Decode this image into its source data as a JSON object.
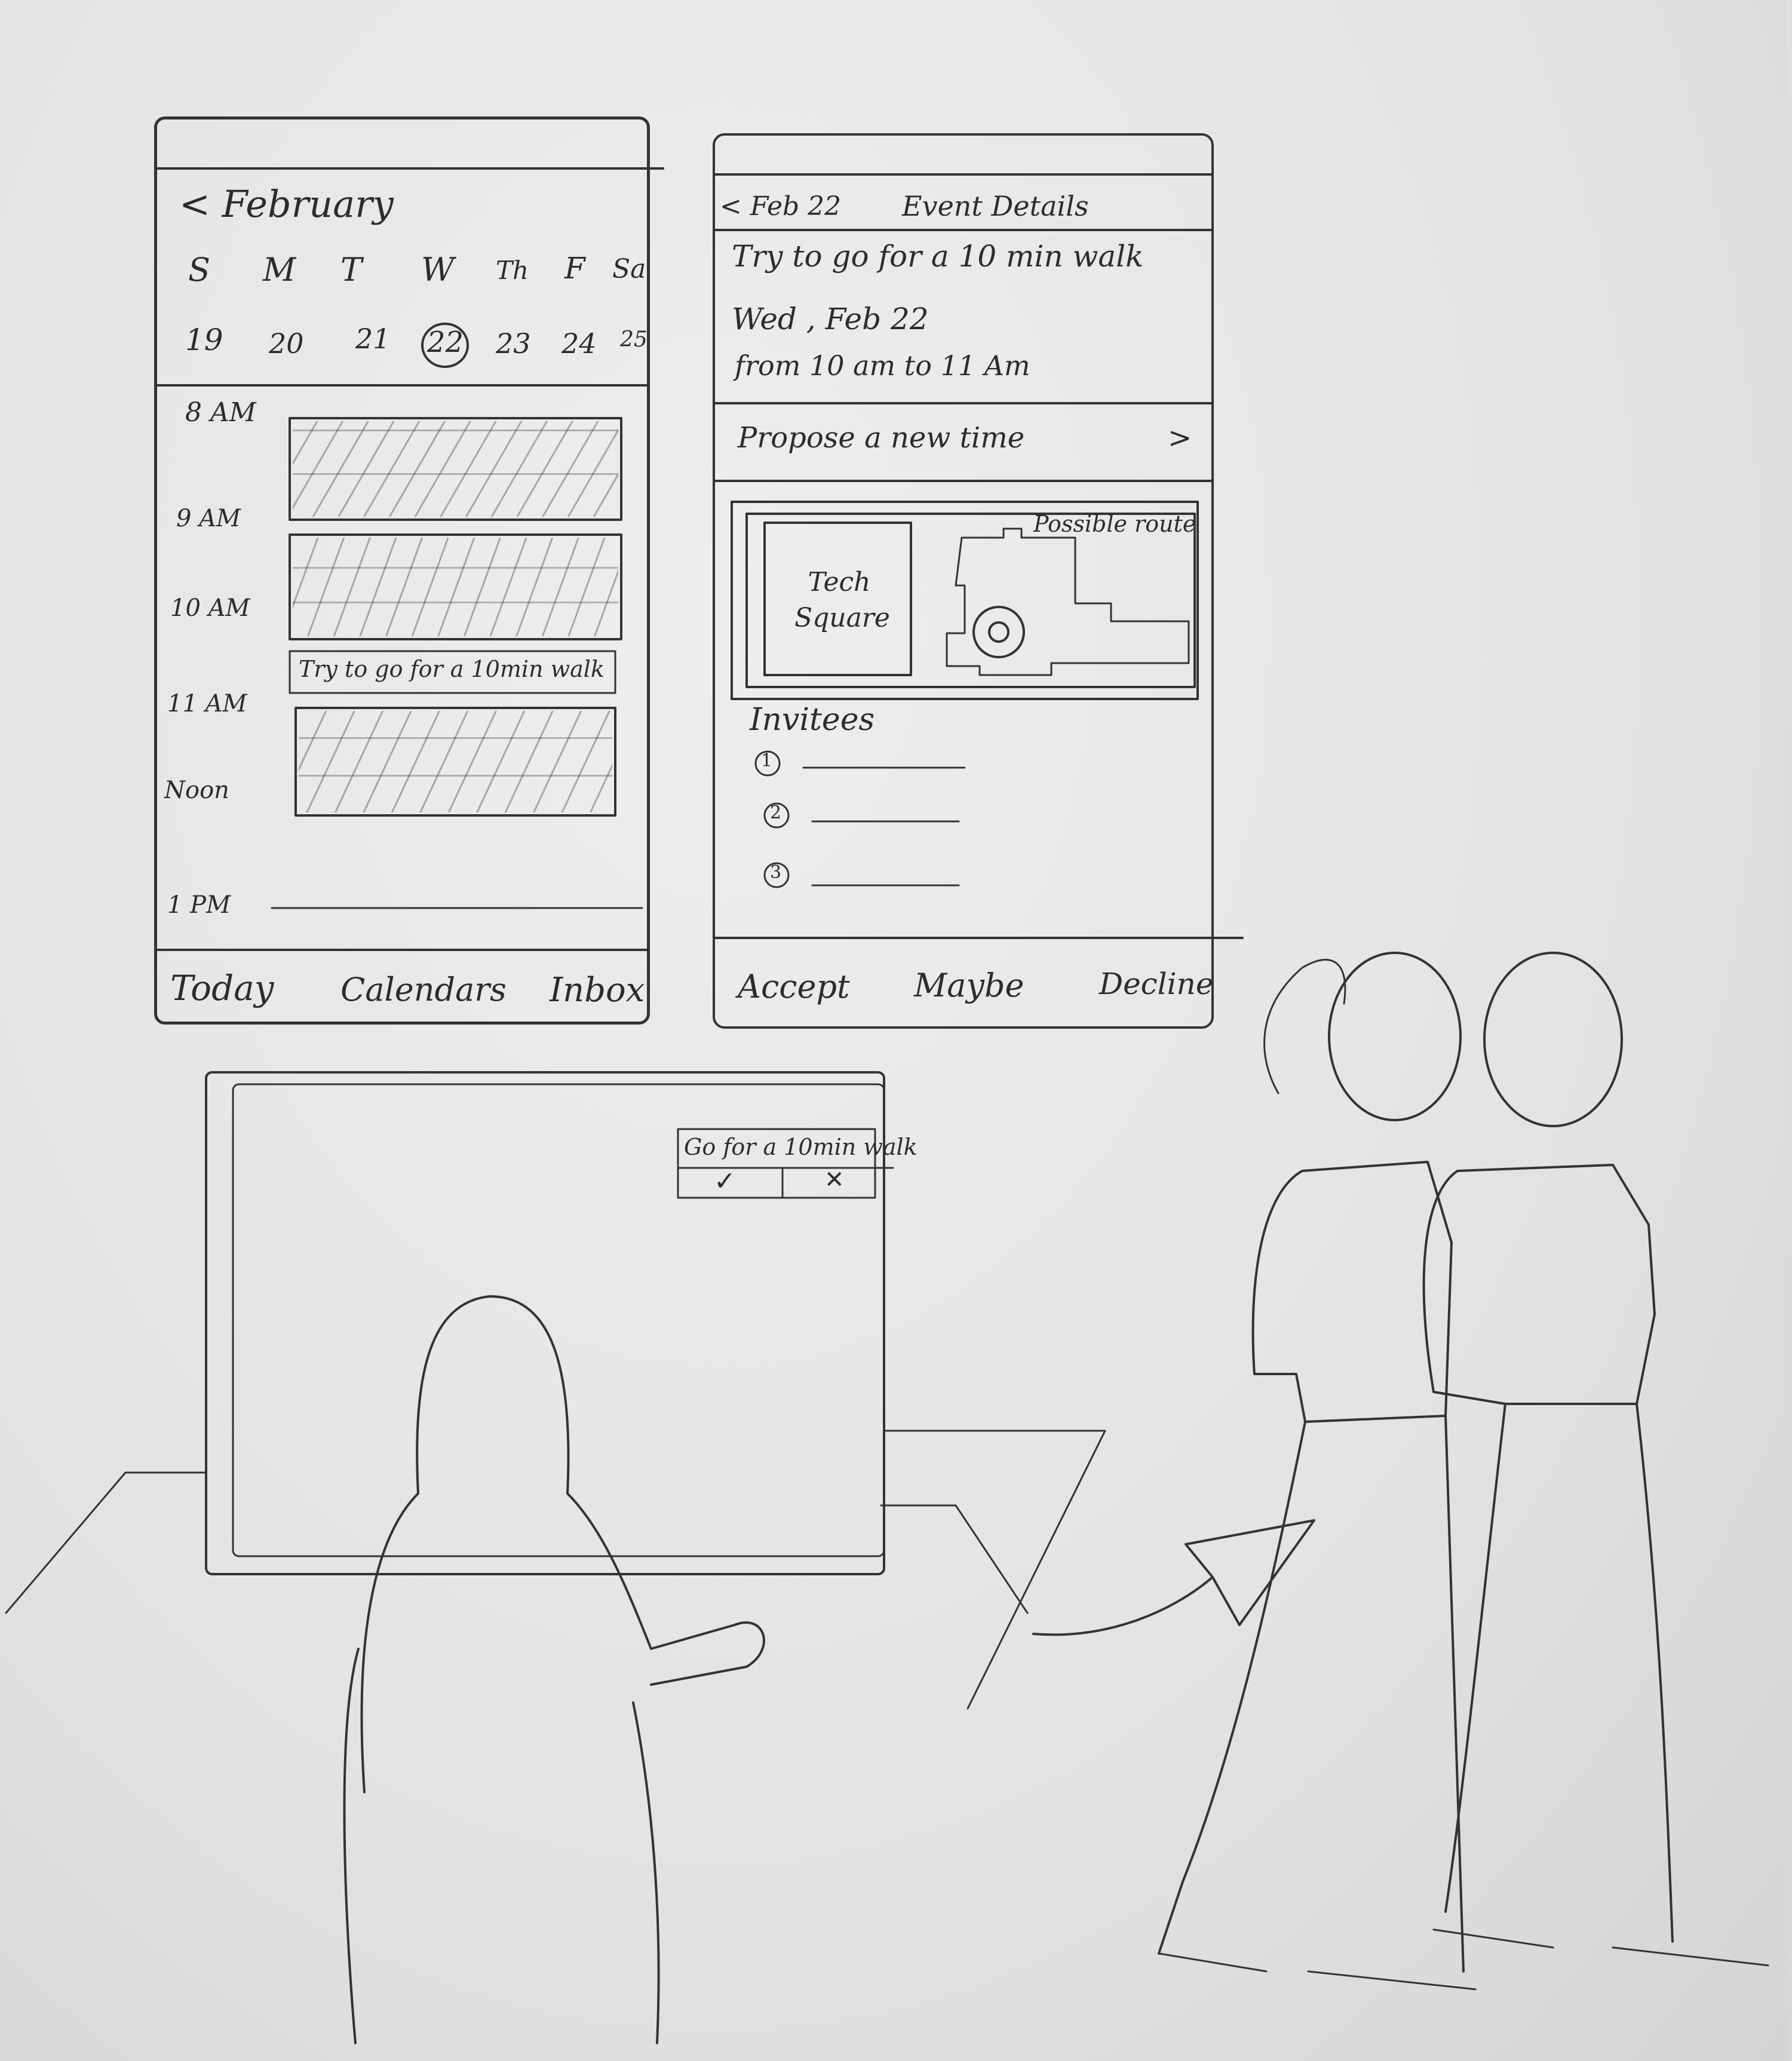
{
  "calendar_screen": {
    "month_back": "< February",
    "weekdays": [
      "S",
      "M",
      "T",
      "W",
      "Th",
      "F",
      "Sa"
    ],
    "dates": [
      "19",
      "20",
      "21",
      "22",
      "23",
      "24",
      "25"
    ],
    "selected_date": "22",
    "times": [
      "8 AM",
      "9 AM",
      "10 AM",
      "11 AM",
      "Noon",
      "1 PM"
    ],
    "event_label": "Try to go for a 10min walk",
    "tabs": [
      "Today",
      "Calendars",
      "Inbox"
    ]
  },
  "event_screen": {
    "back": "< Feb 22",
    "title": "Event Details",
    "event_title": "Try to go for a 10 min walk",
    "date": "Wed , Feb 22",
    "time_range": "from 10 am to 11 Am",
    "propose": "Propose a new time",
    "propose_arrow": ">",
    "map_building": "Tech Square",
    "map_label": "Possible route",
    "invitees_heading": "Invitees",
    "invitees": [
      "1",
      "2",
      "3"
    ],
    "actions": [
      "Accept",
      "Maybe",
      "Decline"
    ]
  },
  "desktop_notification": {
    "text": "Go for a 10min walk",
    "accept_symbol": "✓",
    "reject_symbol": "✕"
  }
}
